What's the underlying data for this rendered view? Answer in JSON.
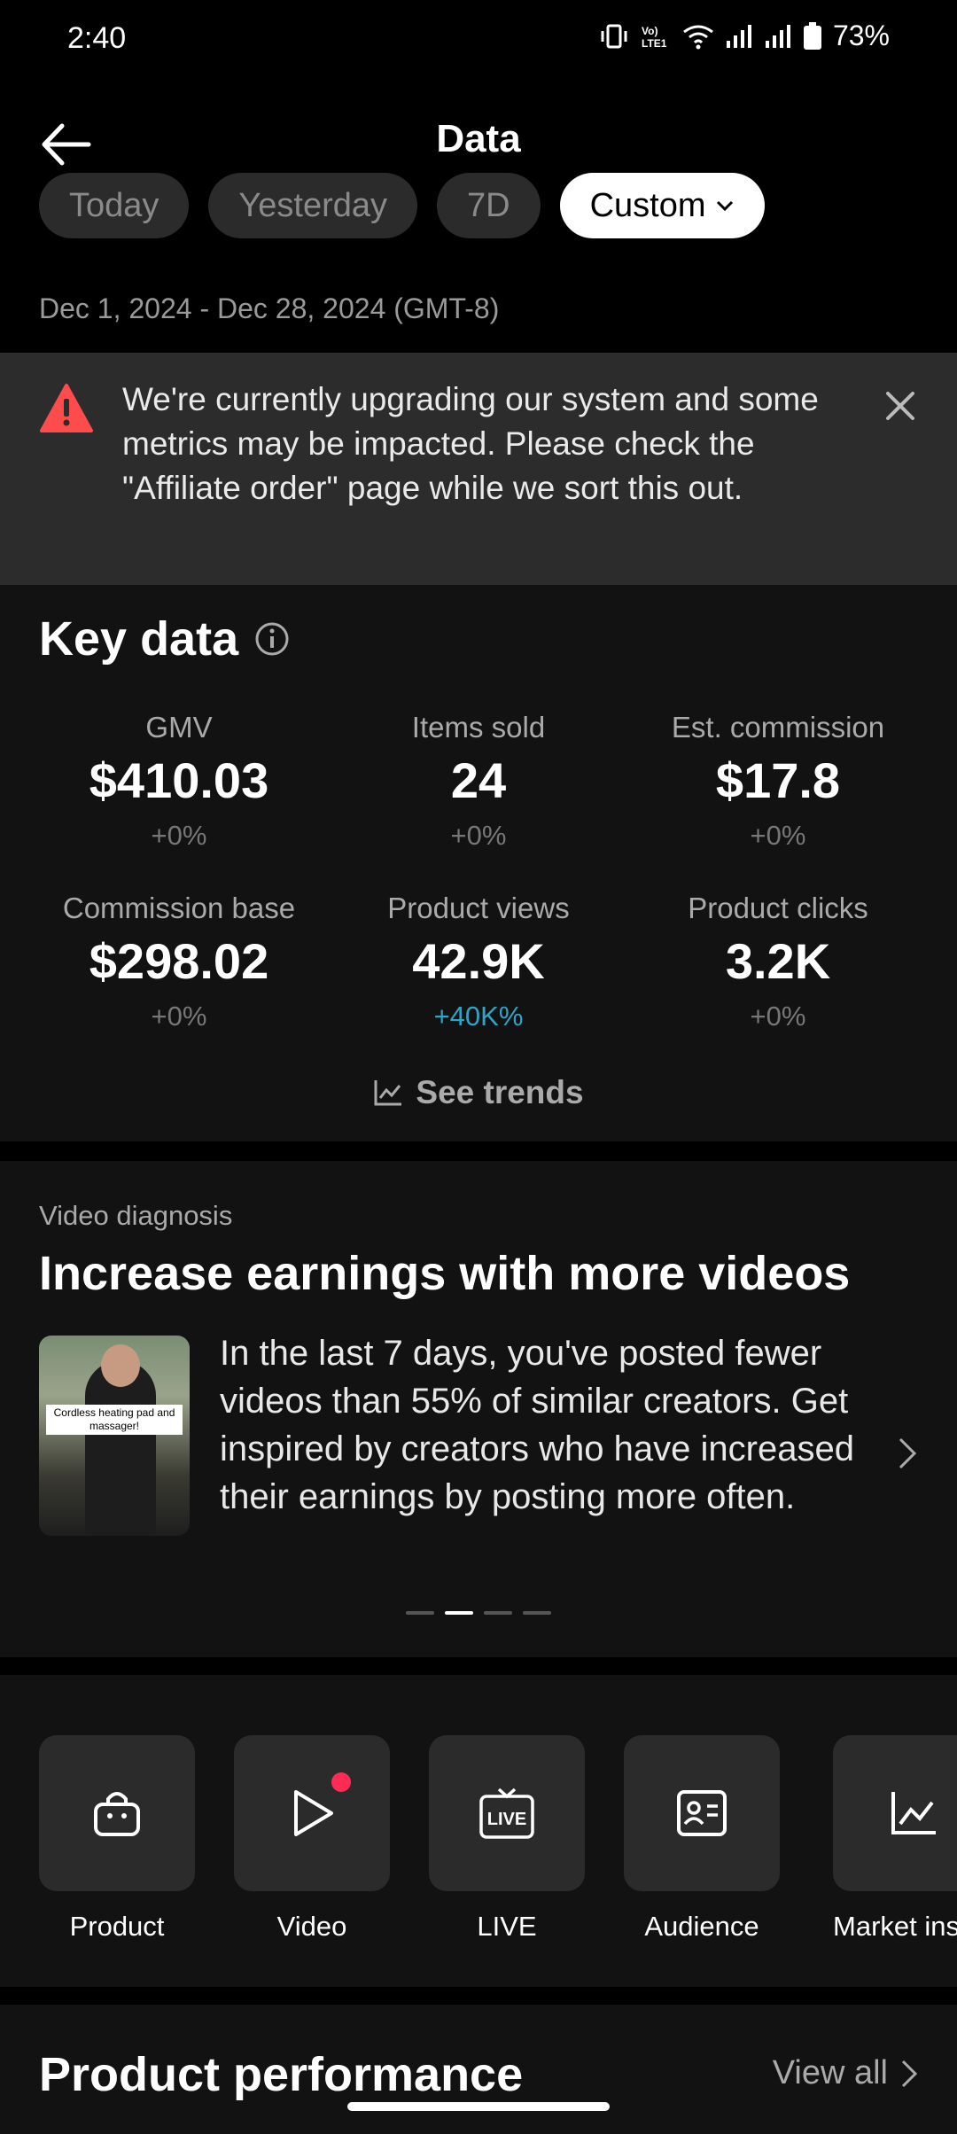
{
  "status_bar": {
    "time": "2:40",
    "battery": "73%"
  },
  "header": {
    "title": "Data"
  },
  "date_filters": {
    "chips": [
      "Today",
      "Yesterday",
      "7D",
      "Custom"
    ],
    "selected": "Custom",
    "range": "Dec 1, 2024 - Dec 28, 2024 (GMT-8)"
  },
  "banner": {
    "text": "We're currently upgrading our system and some metrics may be impacted. Please check the \"Affiliate order\" page while we sort this out."
  },
  "key_data": {
    "title": "Key data",
    "metrics": [
      {
        "label": "GMV",
        "value": "$410.03",
        "change": "+0%"
      },
      {
        "label": "Items sold",
        "value": "24",
        "change": "+0%"
      },
      {
        "label": "Est. commission",
        "value": "$17.8",
        "change": "+0%"
      },
      {
        "label": "Commission base",
        "value": "$298.02",
        "change": "+0%"
      },
      {
        "label": "Product views",
        "value": "42.9K",
        "change": "+40K%"
      },
      {
        "label": "Product clicks",
        "value": "3.2K",
        "change": "+0%"
      }
    ],
    "see_trends": "See trends"
  },
  "diagnosis": {
    "eyebrow": "Video diagnosis",
    "title": "Increase earnings with more videos",
    "thumb_caption": "Cordless heating pad and massager!",
    "body": "In the last 7 days, you've posted fewer videos than 55% of similar creators. Get inspired by creators who have increased their earnings by posting more often."
  },
  "shortcuts": [
    {
      "label": "Product",
      "icon": "shopping-bag-icon"
    },
    {
      "label": "Video",
      "icon": "play-icon"
    },
    {
      "label": "LIVE",
      "icon": "live-tv-icon"
    },
    {
      "label": "Audience",
      "icon": "id-card-icon"
    },
    {
      "label": "Market ins",
      "icon": "chart-icon"
    }
  ],
  "product_performance": {
    "title": "Product performance",
    "link": "View all"
  },
  "colors": {
    "accent_positive": "#2ea4c7",
    "warning": "#fe4c4c",
    "notification_dot": "#fe2c55"
  }
}
